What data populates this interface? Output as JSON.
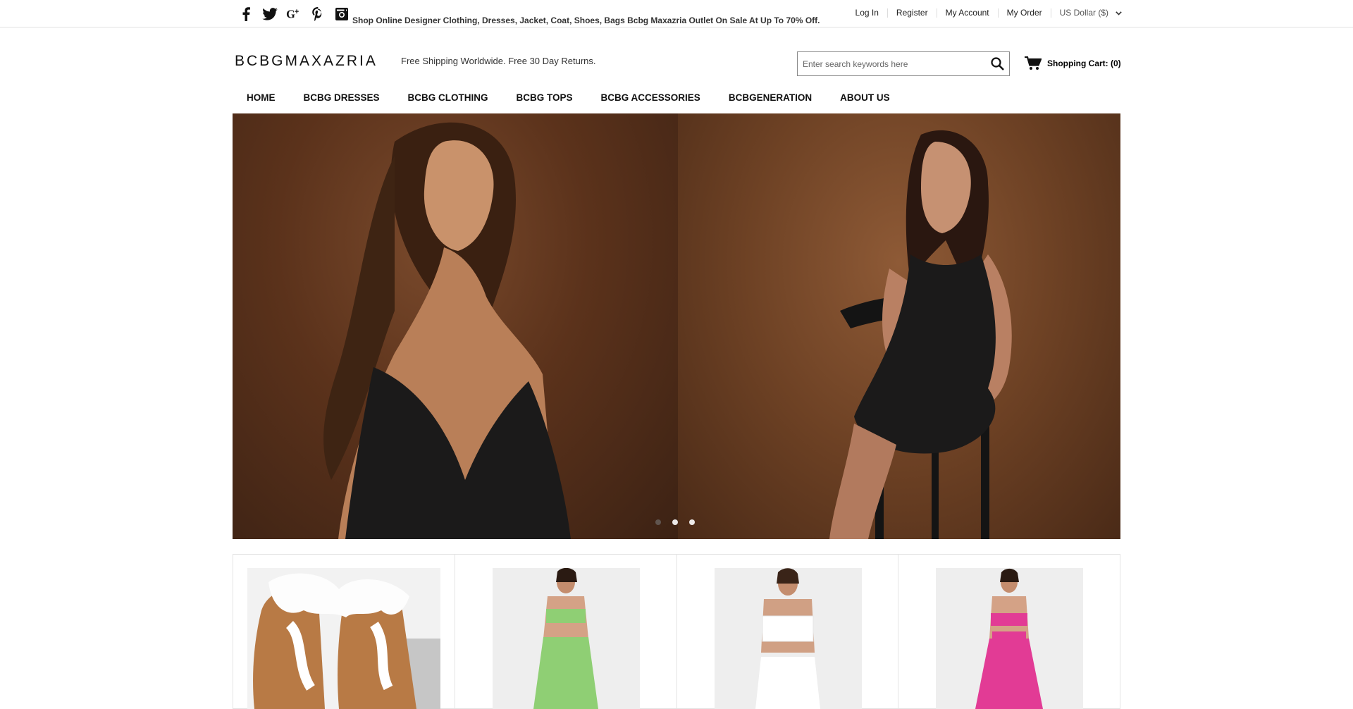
{
  "topbar": {
    "tagline": "Shop Online Designer Clothing, Dresses, Jacket, Coat, Shoes, Bags Bcbg Maxazria Outlet On Sale At Up To 70% Off.",
    "social_icons": [
      "facebook-icon",
      "twitter-icon",
      "google-plus-icon",
      "pinterest-icon",
      "instagram-icon"
    ],
    "links": {
      "login": "Log In",
      "register": "Register",
      "account": "My Account",
      "order": "My Order",
      "currency": "US Dollar ($)"
    }
  },
  "header": {
    "logo": "BCBGMAXAZRIA",
    "shipping": "Free Shipping Worldwide. Free 30 Day Returns.",
    "search_placeholder": "Enter search keywords here",
    "cart_label": "Shopping Cart: (0)"
  },
  "nav": [
    "HOME",
    "BCBG DRESSES",
    "BCBG CLOTHING",
    "BCBG TOPS",
    "BCBG ACCESSORIES",
    "BCBGENERATION",
    "ABOUT US"
  ],
  "hero": {
    "slides": 3,
    "active_slide": 1,
    "colors": {
      "backdrop": "#6d4124",
      "dress": "#1a1a1a"
    }
  },
  "products": [
    {
      "name": "tan-shearling-boots",
      "color": "#b87a45"
    },
    {
      "name": "green-two-piece-set",
      "color": "#8fcf74"
    },
    {
      "name": "white-two-piece-set",
      "color": "#ffffff"
    },
    {
      "name": "pink-two-piece-set",
      "color": "#e23b95"
    }
  ]
}
